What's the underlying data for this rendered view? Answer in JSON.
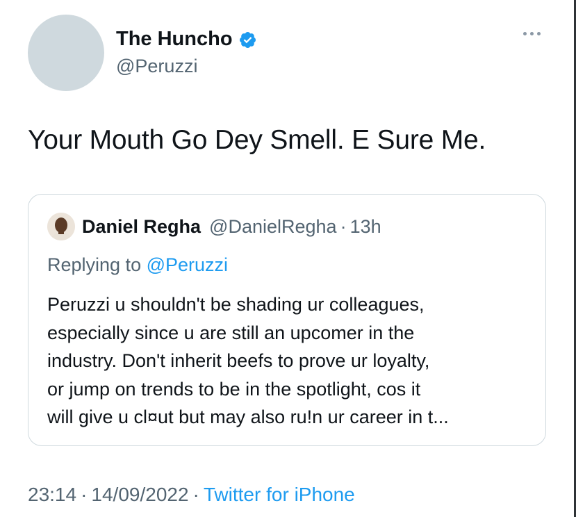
{
  "tweet": {
    "author": {
      "display_name": "The Huncho",
      "handle": "@Peruzzi"
    },
    "text": "Your Mouth Go Dey Smell. E Sure Me.",
    "quote": {
      "display_name": "Daniel Regha",
      "handle": "@DanielRegha",
      "separator": "·",
      "time": "13h",
      "replying_prefix": "Replying to",
      "replying_to": "@Peruzzi",
      "body_lines": [
        "Peruzzi u shouldn't be shading ur colleagues,",
        "especially since u are still an upcomer in the",
        "industry. Don't inherit beefs to prove ur loyalty,",
        "or jump on trends to be in the spotlight, cos it",
        "will give u cl¤ut but may also ru!n ur career in t..."
      ]
    },
    "meta": {
      "time": "23:14",
      "separator": "·",
      "date": "14/09/2022",
      "source": "Twitter for iPhone"
    }
  },
  "icons": {
    "verified": "verified-badge-icon",
    "more": "more-options-icon"
  },
  "colors": {
    "accent": "#1d9bf0",
    "secondary_text": "#536471",
    "border": "#cfd9de",
    "avatar_placeholder": "#cfd9de"
  }
}
